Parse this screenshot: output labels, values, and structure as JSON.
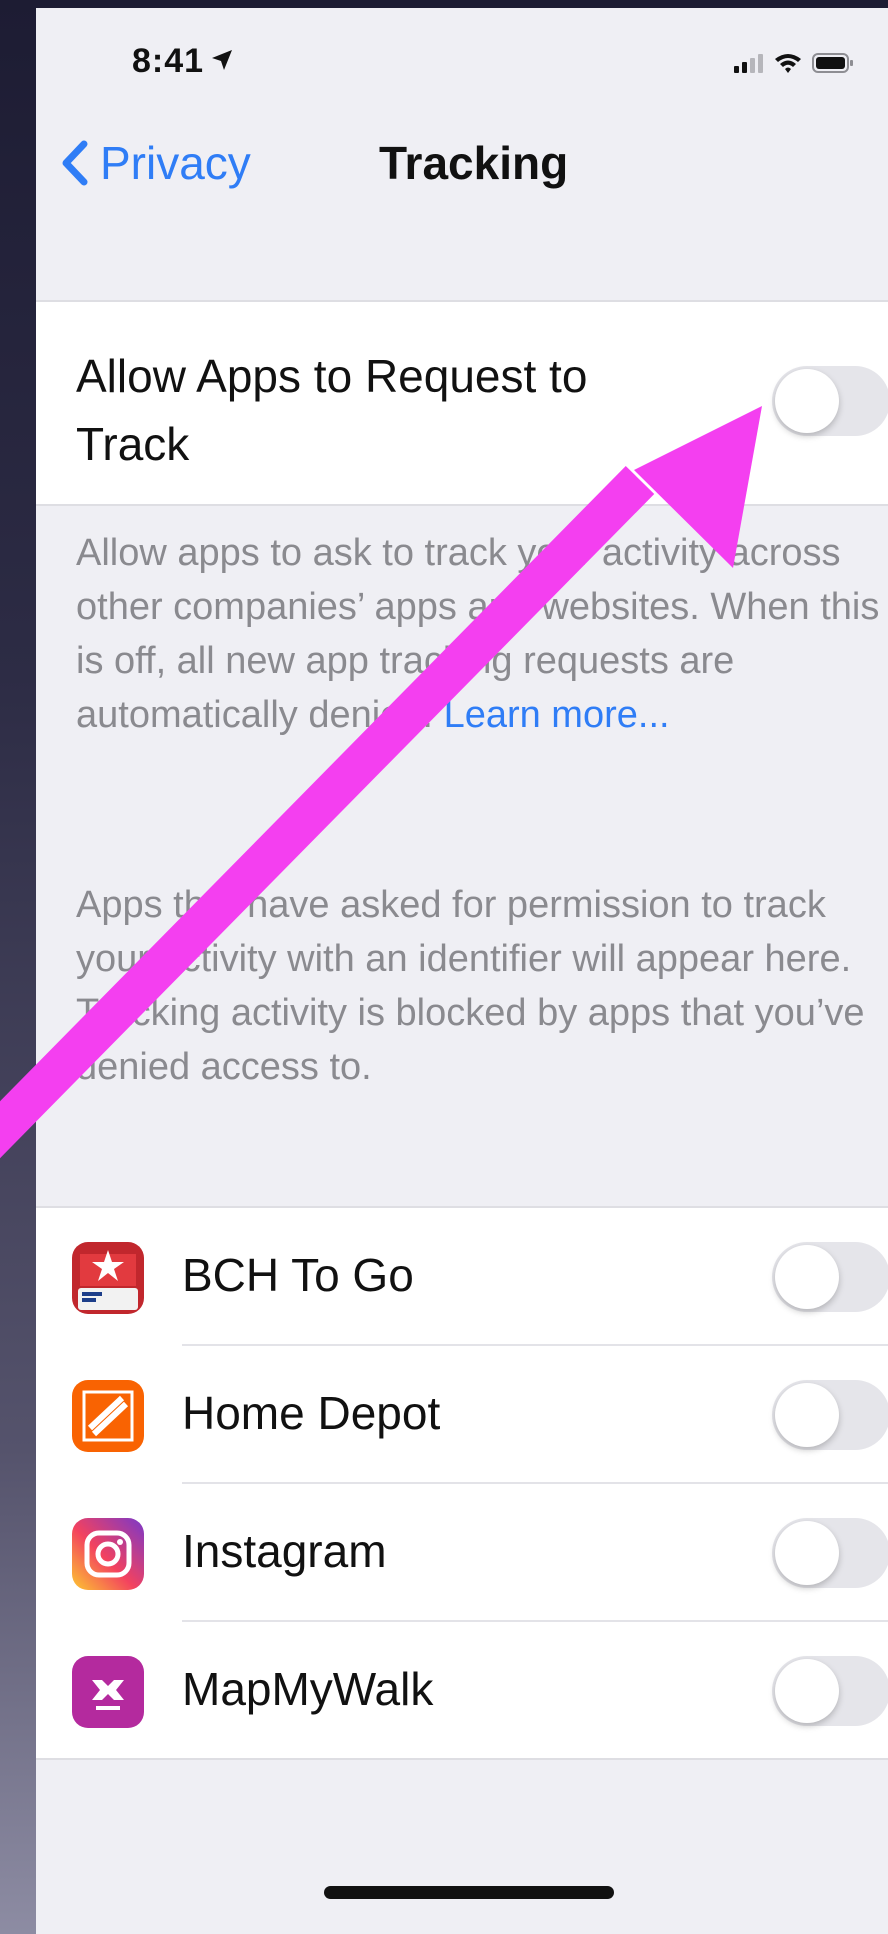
{
  "status_bar": {
    "time": "8:41"
  },
  "nav": {
    "back_label": "Privacy",
    "title": "Tracking"
  },
  "allow_setting": {
    "label": "Allow Apps to Request to Track",
    "enabled": false
  },
  "description": {
    "text": "Allow apps to ask to track your activity across other companies’ apps and websites. When this is off, all new app tracking requests are automatically denied.",
    "learn_more": "Learn more..."
  },
  "info": {
    "text": "Apps that have asked for permission to track your activity with an identifier will appear here. Tracking activity is blocked by apps that you’ve denied access to."
  },
  "apps": [
    {
      "name": "BCH To Go",
      "icon": "bch-to-go-app-icon",
      "enabled": false
    },
    {
      "name": "Home Depot",
      "icon": "home-depot-app-icon",
      "enabled": false
    },
    {
      "name": "Instagram",
      "icon": "instagram-app-icon",
      "enabled": false
    },
    {
      "name": "MapMyWalk",
      "icon": "mapmywalk-app-icon",
      "enabled": false
    }
  ],
  "colors": {
    "accent": "#2f7df6",
    "annotation_arrow": "#f43ff0",
    "toggle_off": "#e5e5ea"
  }
}
